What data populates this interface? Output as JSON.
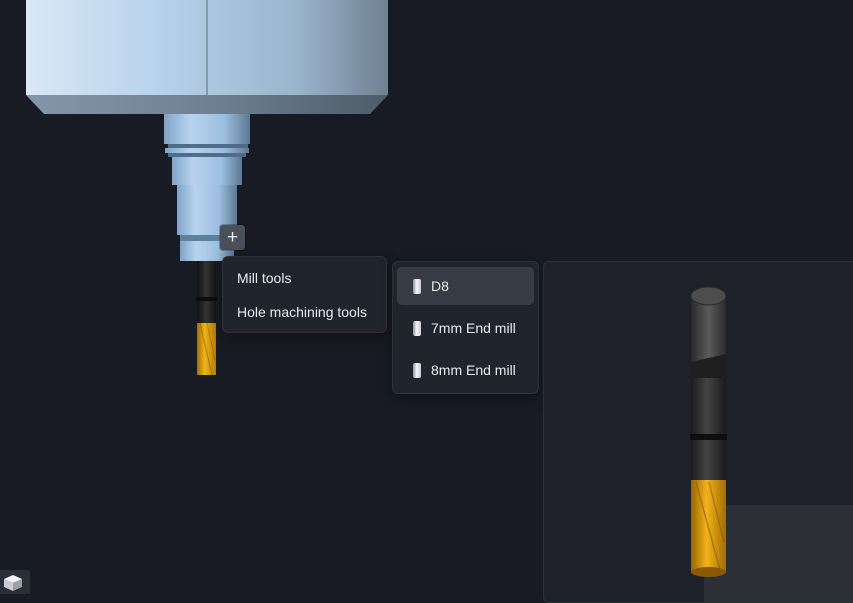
{
  "scene": {
    "add_button_symbol": "+",
    "spindle_icon": "spindle-model",
    "tool_model_icon": "end-mill-model"
  },
  "category_menu": {
    "items": [
      {
        "label": "Mill tools"
      },
      {
        "label": "Hole machining tools"
      }
    ]
  },
  "tool_menu": {
    "items": [
      {
        "label": "D8",
        "icon": "end-mill-icon",
        "selected": true
      },
      {
        "label": "7mm End mill",
        "icon": "end-mill-icon",
        "selected": false
      },
      {
        "label": "8mm End mill",
        "icon": "end-mill-icon",
        "selected": false
      }
    ]
  },
  "view_cube": {
    "icon": "view-cube-icon"
  },
  "colors": {
    "background": "#181b23",
    "spindle_blue": "#a8c6e4",
    "tool_gold": "#e0a010",
    "tool_dark": "#2a2a2a"
  }
}
